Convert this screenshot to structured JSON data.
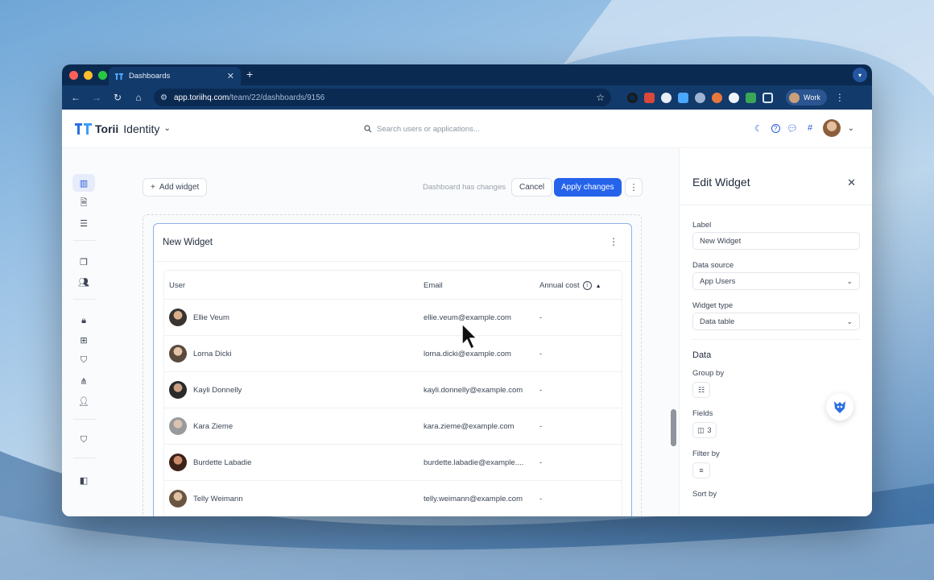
{
  "browser": {
    "tab_title": "Dashboards",
    "url_host": "app.toriihq.com",
    "url_path": "/team/22/dashboards/9156",
    "profile_label": "Work"
  },
  "app": {
    "logo_text": "Torii",
    "product_name": "Identity",
    "search_placeholder": "Search users or applications..."
  },
  "toolbar": {
    "add_widget_label": "Add widget",
    "changes_text": "Dashboard has changes",
    "cancel_label": "Cancel",
    "apply_label": "Apply changes"
  },
  "widget": {
    "title": "New Widget",
    "columns": [
      "User",
      "Email",
      "Annual cost"
    ],
    "rows": [
      {
        "user": "Ellie Veum",
        "email": "ellie.veum@example.com",
        "cost": "-"
      },
      {
        "user": "Lorna Dicki",
        "email": "lorna.dicki@example.com",
        "cost": "-"
      },
      {
        "user": "Kayli Donnelly",
        "email": "kayli.donnelly@example.com",
        "cost": "-"
      },
      {
        "user": "Kara Zieme",
        "email": "kara.zieme@example.com",
        "cost": "-"
      },
      {
        "user": "Burdette Labadie",
        "email": "burdette.labadie@example....",
        "cost": "-"
      },
      {
        "user": "Telly Weimann",
        "email": "telly.weimann@example.com",
        "cost": "-"
      }
    ]
  },
  "panel": {
    "title": "Edit Widget",
    "label_label": "Label",
    "label_value": "New Widget",
    "data_source_label": "Data source",
    "data_source_value": "App Users",
    "widget_type_label": "Widget type",
    "widget_type_value": "Data table",
    "data_section": "Data",
    "group_by_label": "Group by",
    "fields_label": "Fields",
    "fields_count": "3",
    "filter_by_label": "Filter by",
    "sort_by_label": "Sort by"
  },
  "colors": {
    "accent": "#2563eb",
    "chrome_dark": "#0b2a52",
    "chrome_mid": "#123a6b"
  }
}
